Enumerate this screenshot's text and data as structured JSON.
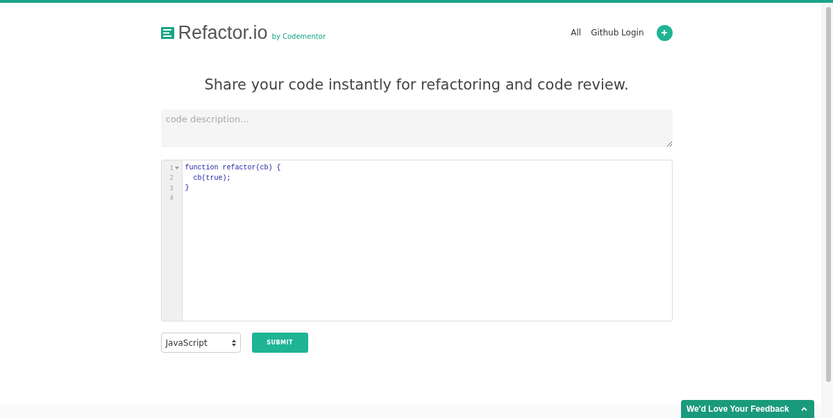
{
  "header": {
    "logo": "Refactor.io",
    "byline": "by Codementor",
    "nav": [
      {
        "label": "All"
      },
      {
        "label": "Github Login"
      }
    ]
  },
  "headline": "Share your code instantly for refactoring and code review.",
  "description": {
    "placeholder": "code description..."
  },
  "editor": {
    "lines": [
      {
        "number": "1",
        "foldable": true,
        "code": "function refactor(cb) {"
      },
      {
        "number": "2",
        "foldable": false,
        "code": "  cb(true);"
      },
      {
        "number": "3",
        "foldable": false,
        "code": "}"
      },
      {
        "number": "4",
        "foldable": false
      }
    ]
  },
  "language": {
    "value": "JavaScript"
  },
  "submit": "SUBMIT",
  "feedback": "We'd Love Your Feedback"
}
